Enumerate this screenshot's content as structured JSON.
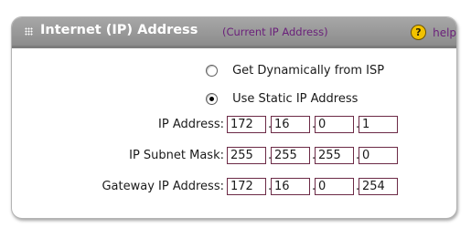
{
  "section": {
    "title": "Internet (IP) Address",
    "subtitle": "(Current IP Address)",
    "help_glyph": "?",
    "help_label": "help",
    "icons": {
      "grip": "grip-icon",
      "help": "help-icon"
    }
  },
  "mode": {
    "options": [
      {
        "label": "Get Dynamically from ISP",
        "checked": false
      },
      {
        "label": "Use Static IP Address",
        "checked": true
      }
    ]
  },
  "fields": [
    {
      "label": "IP Address:",
      "octets": [
        "172",
        "16",
        "0",
        "1"
      ]
    },
    {
      "label": "IP Subnet Mask:",
      "octets": [
        "255",
        "255",
        "255",
        "0"
      ]
    },
    {
      "label": "Gateway IP Address:",
      "octets": [
        "172",
        "16",
        "0",
        "254"
      ]
    }
  ],
  "separator": ".",
  "colors": {
    "header_bg": "#9b9b9b",
    "subtitle_text": "#6a1f7a",
    "input_border": "#6c2a46",
    "help_icon_bg": "#f2c200"
  }
}
